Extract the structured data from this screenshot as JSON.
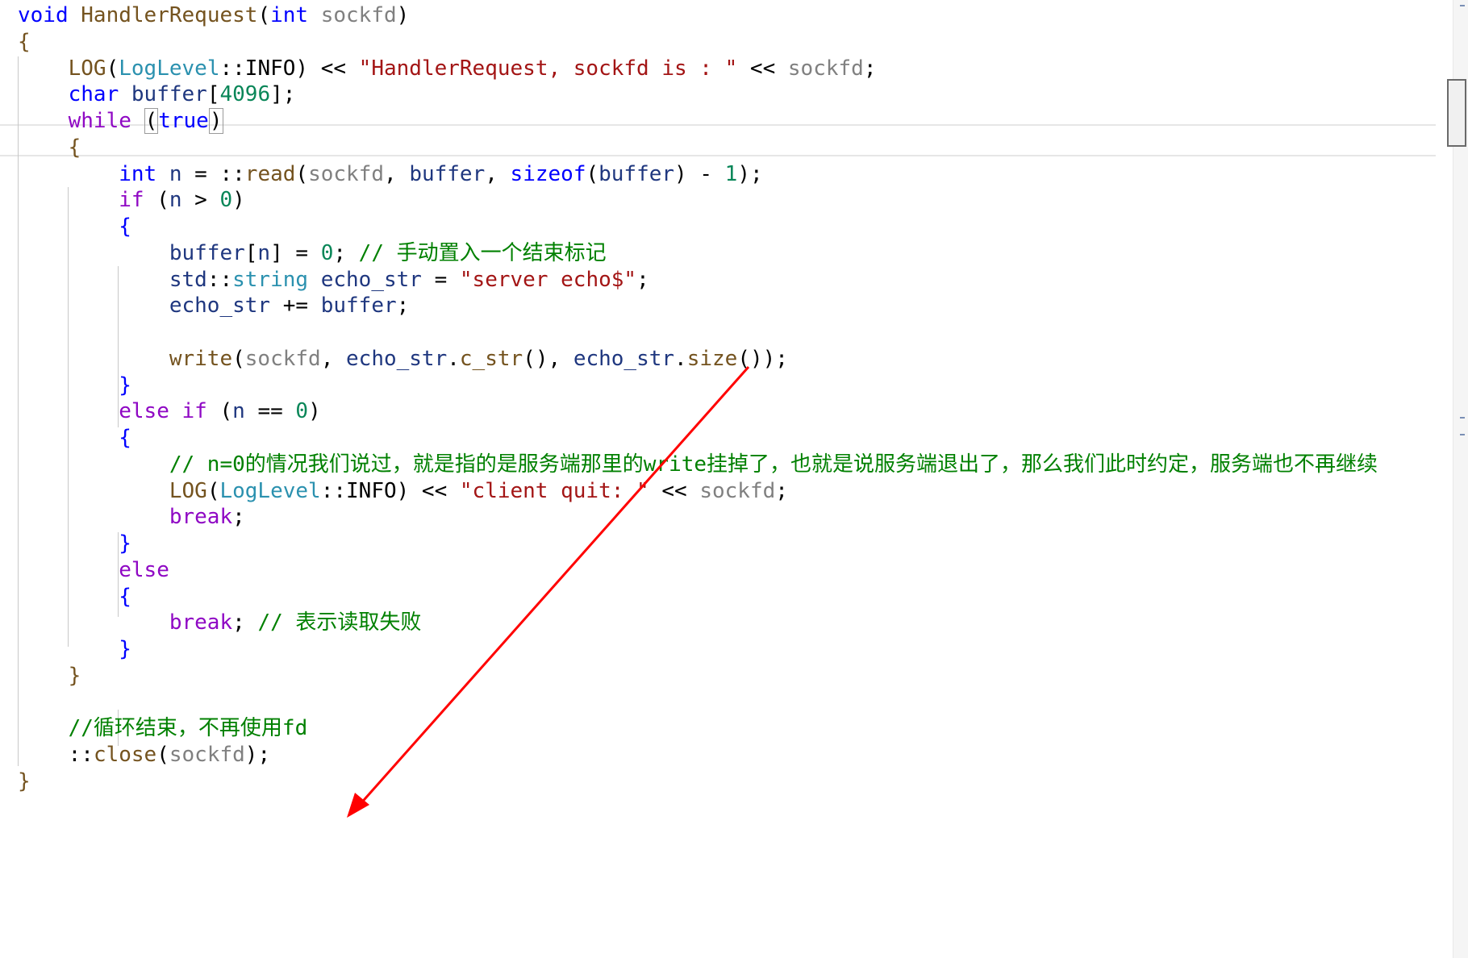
{
  "theme": {
    "background": "#ffffff",
    "keyword": "#0000ff",
    "control": "#8f08c4",
    "type": "#2b91af",
    "function": "#74531f",
    "string": "#a31515",
    "comment": "#008000",
    "number": "#098658",
    "parameter": "#808080",
    "identifier": "#1f377f",
    "punctuation": "#000000",
    "annotation_arrow": "#ff0000"
  },
  "code": {
    "lines": [
      [
        [
          "void",
          "keyword"
        ],
        [
          " ",
          "punctuation"
        ],
        [
          "HandlerRequest",
          "function"
        ],
        [
          "(",
          "punctuation"
        ],
        [
          "int",
          "keyword"
        ],
        [
          " ",
          "punctuation"
        ],
        [
          "sockfd",
          "parameter"
        ],
        [
          ")",
          "punctuation"
        ]
      ],
      [
        [
          "{",
          "function"
        ]
      ],
      [
        [
          "    ",
          "punctuation"
        ],
        [
          "LOG",
          "function"
        ],
        [
          "(",
          "punctuation"
        ],
        [
          "LogLevel",
          "type"
        ],
        [
          "::INFO) << ",
          "punctuation"
        ],
        [
          "\"HandlerRequest, sockfd is : \"",
          "string"
        ],
        [
          " << ",
          "punctuation"
        ],
        [
          "sockfd",
          "parameter"
        ],
        [
          ";",
          "punctuation"
        ]
      ],
      [
        [
          "    ",
          "punctuation"
        ],
        [
          "char",
          "keyword"
        ],
        [
          " ",
          "punctuation"
        ],
        [
          "buffer",
          "identifier"
        ],
        [
          "[",
          "punctuation"
        ],
        [
          "4096",
          "number"
        ],
        [
          "];",
          "punctuation"
        ]
      ],
      [
        [
          "    ",
          "punctuation"
        ],
        [
          "while",
          "control"
        ],
        [
          " ",
          "punctuation"
        ],
        [
          "(",
          "bracket"
        ],
        [
          "true",
          "keyword"
        ],
        [
          ")",
          "bracket"
        ]
      ],
      [
        [
          "    ",
          "punctuation"
        ],
        [
          "{",
          "function"
        ]
      ],
      [
        [
          "        ",
          "punctuation"
        ],
        [
          "int",
          "keyword"
        ],
        [
          " ",
          "punctuation"
        ],
        [
          "n",
          "identifier"
        ],
        [
          " = ::",
          "punctuation"
        ],
        [
          "read",
          "function"
        ],
        [
          "(",
          "punctuation"
        ],
        [
          "sockfd",
          "parameter"
        ],
        [
          ", ",
          "punctuation"
        ],
        [
          "buffer",
          "identifier"
        ],
        [
          ", ",
          "punctuation"
        ],
        [
          "sizeof",
          "keyword"
        ],
        [
          "(",
          "punctuation"
        ],
        [
          "buffer",
          "identifier"
        ],
        [
          ") - ",
          "punctuation"
        ],
        [
          "1",
          "number"
        ],
        [
          ");",
          "punctuation"
        ]
      ],
      [
        [
          "        ",
          "punctuation"
        ],
        [
          "if",
          "control"
        ],
        [
          " (",
          "punctuation"
        ],
        [
          "n",
          "identifier"
        ],
        [
          " > ",
          "punctuation"
        ],
        [
          "0",
          "number"
        ],
        [
          ")",
          "punctuation"
        ]
      ],
      [
        [
          "        ",
          "punctuation"
        ],
        [
          "{",
          "keyword"
        ]
      ],
      [
        [
          "            ",
          "punctuation"
        ],
        [
          "buffer",
          "identifier"
        ],
        [
          "[",
          "punctuation"
        ],
        [
          "n",
          "identifier"
        ],
        [
          "] = ",
          "punctuation"
        ],
        [
          "0",
          "number"
        ],
        [
          "; ",
          "punctuation"
        ],
        [
          "// 手动置入一个结束标记",
          "comment"
        ]
      ],
      [
        [
          "            ",
          "punctuation"
        ],
        [
          "std",
          "identifier"
        ],
        [
          "::",
          "punctuation"
        ],
        [
          "string",
          "type"
        ],
        [
          " ",
          "punctuation"
        ],
        [
          "echo_str",
          "identifier"
        ],
        [
          " = ",
          "punctuation"
        ],
        [
          "\"server echo$\"",
          "string"
        ],
        [
          ";",
          "punctuation"
        ]
      ],
      [
        [
          "            ",
          "punctuation"
        ],
        [
          "echo_str",
          "identifier"
        ],
        [
          " += ",
          "punctuation"
        ],
        [
          "buffer",
          "identifier"
        ],
        [
          ";",
          "punctuation"
        ]
      ],
      [
        [
          "",
          "punctuation"
        ]
      ],
      [
        [
          "            ",
          "punctuation"
        ],
        [
          "write",
          "function"
        ],
        [
          "(",
          "punctuation"
        ],
        [
          "sockfd",
          "parameter"
        ],
        [
          ", ",
          "punctuation"
        ],
        [
          "echo_str",
          "identifier"
        ],
        [
          ".",
          "punctuation"
        ],
        [
          "c_str",
          "function"
        ],
        [
          "(), ",
          "punctuation"
        ],
        [
          "echo_str",
          "identifier"
        ],
        [
          ".",
          "punctuation"
        ],
        [
          "size",
          "function"
        ],
        [
          "());",
          "punctuation"
        ]
      ],
      [
        [
          "        ",
          "punctuation"
        ],
        [
          "}",
          "keyword"
        ]
      ],
      [
        [
          "        ",
          "punctuation"
        ],
        [
          "else",
          "control"
        ],
        [
          " ",
          "punctuation"
        ],
        [
          "if",
          "control"
        ],
        [
          " (",
          "punctuation"
        ],
        [
          "n",
          "identifier"
        ],
        [
          " == ",
          "punctuation"
        ],
        [
          "0",
          "number"
        ],
        [
          ")",
          "punctuation"
        ]
      ],
      [
        [
          "        ",
          "punctuation"
        ],
        [
          "{",
          "keyword"
        ]
      ],
      [
        [
          "            ",
          "punctuation"
        ],
        [
          "// n=0的情况我们说过，就是指的是服务端那里的write挂掉了，也就是说服务端退出了，那么我们此时约定，服务端也不再继续",
          "comment"
        ]
      ],
      [
        [
          "            ",
          "punctuation"
        ],
        [
          "LOG",
          "function"
        ],
        [
          "(",
          "punctuation"
        ],
        [
          "LogLevel",
          "type"
        ],
        [
          "::INFO) << ",
          "punctuation"
        ],
        [
          "\"client quit: \"",
          "string"
        ],
        [
          " << ",
          "punctuation"
        ],
        [
          "sockfd",
          "parameter"
        ],
        [
          ";",
          "punctuation"
        ]
      ],
      [
        [
          "            ",
          "punctuation"
        ],
        [
          "break",
          "control"
        ],
        [
          ";",
          "punctuation"
        ]
      ],
      [
        [
          "        ",
          "punctuation"
        ],
        [
          "}",
          "keyword"
        ]
      ],
      [
        [
          "        ",
          "punctuation"
        ],
        [
          "else",
          "control"
        ]
      ],
      [
        [
          "        ",
          "punctuation"
        ],
        [
          "{",
          "keyword"
        ]
      ],
      [
        [
          "            ",
          "punctuation"
        ],
        [
          "break",
          "control"
        ],
        [
          "; ",
          "punctuation"
        ],
        [
          "// 表示读取失败",
          "comment"
        ]
      ],
      [
        [
          "        ",
          "punctuation"
        ],
        [
          "}",
          "keyword"
        ]
      ],
      [
        [
          "    ",
          "punctuation"
        ],
        [
          "}",
          "function"
        ]
      ],
      [
        [
          "",
          "punctuation"
        ]
      ],
      [
        [
          "    ",
          "punctuation"
        ],
        [
          "//循环结束，不再使用fd",
          "comment"
        ]
      ],
      [
        [
          "    ",
          "punctuation"
        ],
        [
          "::",
          "punctuation"
        ],
        [
          "close",
          "function"
        ],
        [
          "(",
          "punctuation"
        ],
        [
          "sockfd",
          "parameter"
        ],
        [
          ");",
          "punctuation"
        ]
      ],
      [
        [
          "}",
          "function"
        ]
      ]
    ]
  }
}
